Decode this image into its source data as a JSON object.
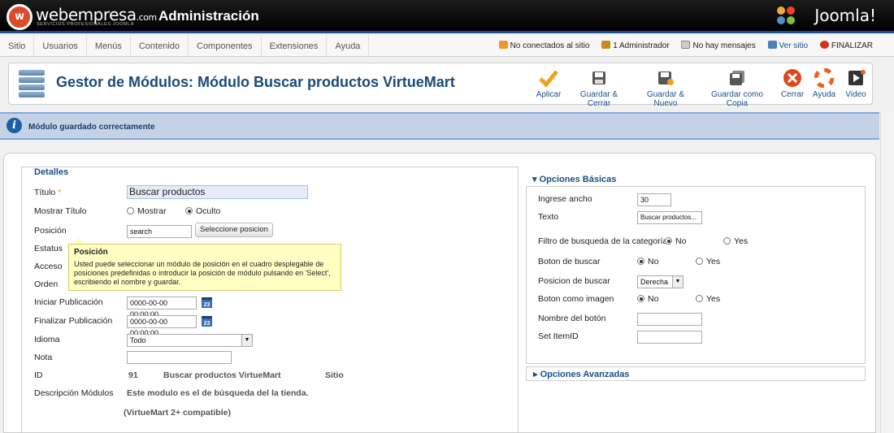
{
  "header": {
    "brand_main": "webempresa",
    "brand_suffix": ".com",
    "brand_sub": "SERVICIOS PROFESIONALES JOOMLA",
    "admin_title": "Administración",
    "joomla_label": "Joomla!"
  },
  "menu": [
    "Sitio",
    "Usuarios",
    "Menús",
    "Contenido",
    "Componentes",
    "Extensiones",
    "Ayuda"
  ],
  "status": {
    "connected": "No conectados al sitio",
    "admins": "1 Administrador",
    "messages": "No hay mensajes",
    "view_site": "Ver sitio",
    "logout": "FINALIZAR"
  },
  "toolbar": {
    "title": "Gestor de Módulos: Módulo Buscar productos VirtueMart",
    "buttons": [
      "Aplicar",
      "Guardar & Cerrar",
      "Guardar & Nuevo",
      "Guardar como Copia",
      "Cerrar",
      "Ayuda",
      "Video"
    ]
  },
  "message": "Módulo guardado correctamente",
  "details": {
    "legend": "Detalles",
    "labels": {
      "title": "Título",
      "show_title": "Mostrar Título",
      "position": "Posición",
      "status": "Estatus",
      "access": "Acceso",
      "order": "Orden",
      "publish_up": "Iniciar Publicación",
      "publish_down": "Finalizar Publicación",
      "language": "Idioma",
      "note": "Nota",
      "id": "ID",
      "description": "Descripción Módulos"
    },
    "required_mark": "*",
    "title_value": "Buscar productos",
    "show_title_options": [
      "Mostrar",
      "Oculto"
    ],
    "show_title_selected": "Oculto",
    "position_value": "search",
    "select_position_button": "Seleccione posicion",
    "publish_up_value": "0000-00-00 00:00:00",
    "publish_down_value": "0000-00-00 00:00:00",
    "calendar_label": "23",
    "language_value": "Todo",
    "note_value": "",
    "id_value": "91",
    "module_name": "Buscar productos VirtueMart",
    "client": "Sitio",
    "description_line1": "Este modulo es el de búsqueda del la tienda.",
    "description_line2": "(VirtueMart 2+ compatible)"
  },
  "tooltip": {
    "title": "Posición",
    "body": "Usted puede seleccionar un módulo de posición en el cuadro desplegable de posiciones predefinidas o introducir la posición de módulo pulsando en 'Select', escribiendo el nombre y guardar."
  },
  "basic_options": {
    "heading": "Opciones Básicas",
    "width_label": "Ingrese ancho",
    "width_value": "30",
    "text_label": "Texto",
    "text_value": "Buscar productos...",
    "cat_filter_label": "Filtro de busqueda de la categoría",
    "search_button_label": "Boton de buscar",
    "button_position_label": "Posicion de buscar",
    "button_position_value": "Derecha",
    "button_image_label": "Boton como imagen",
    "button_name_label": "Nombre del botón",
    "itemid_label": "Set ItemID",
    "no": "No",
    "yes": "Yes"
  },
  "advanced_options": {
    "heading": "Opciones Avanzadas"
  },
  "colors": {
    "accent": "#1a4f8b",
    "message_bg": "#c3d2e5",
    "tooltip_bg": "#ffffc4"
  }
}
